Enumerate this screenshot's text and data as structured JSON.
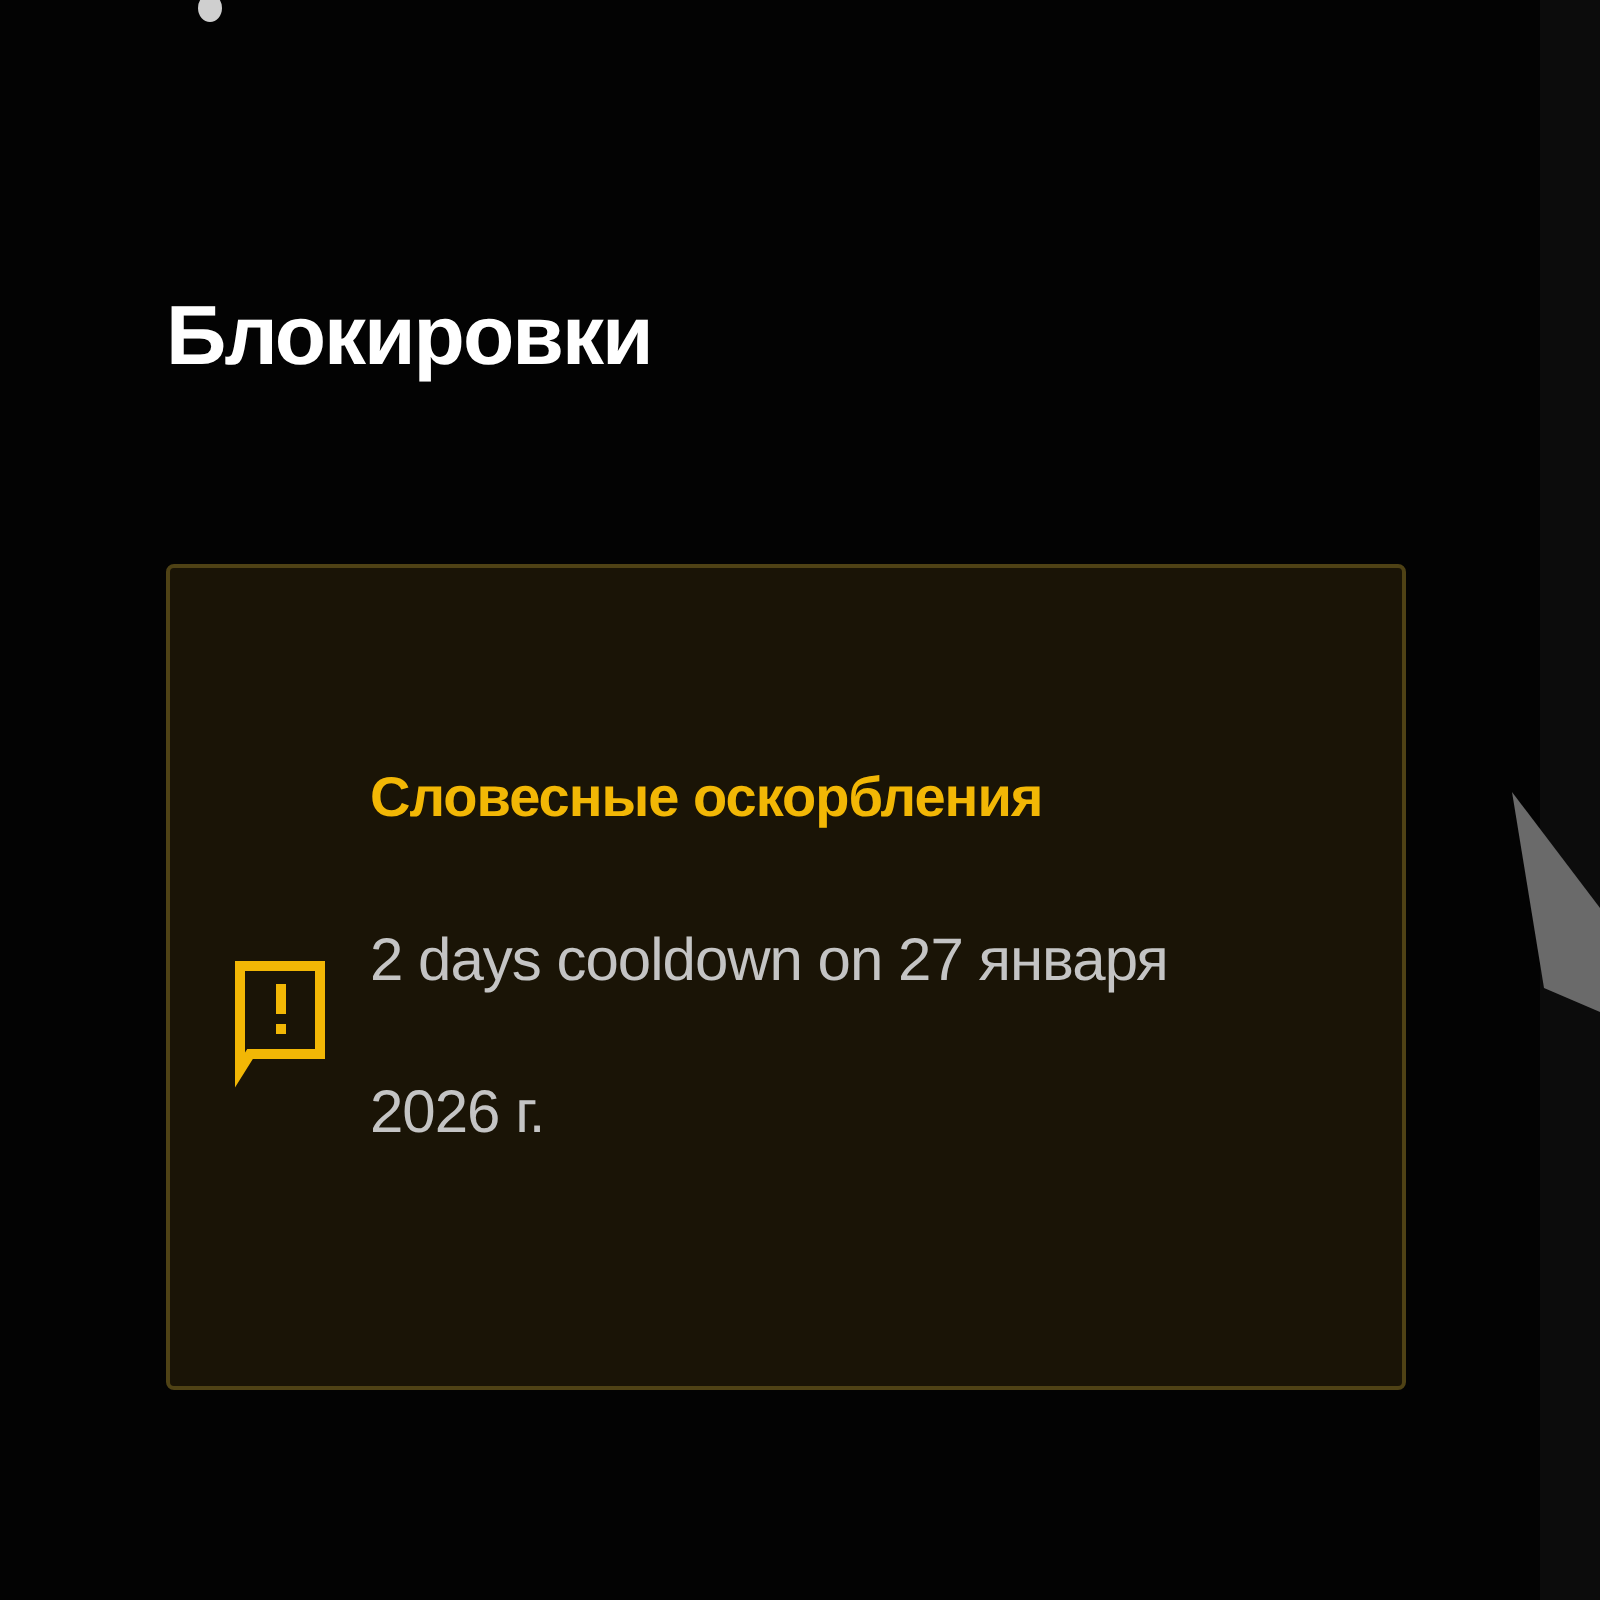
{
  "heading": "Блокировки",
  "blocks": [
    {
      "kind": "warning",
      "title": "Словесные оскорбления",
      "description": "2 days cooldown on 27 января 2026 г."
    }
  ]
}
